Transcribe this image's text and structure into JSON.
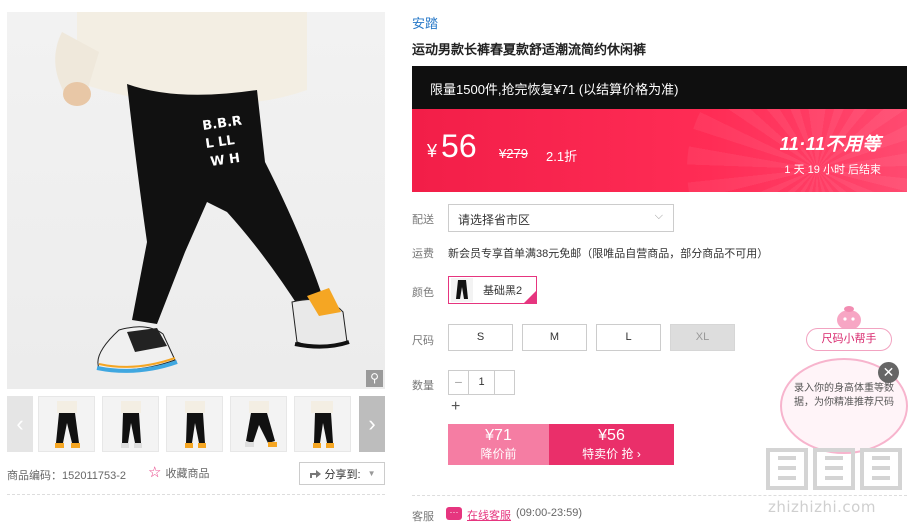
{
  "gallery": {
    "zoom_icon": "zoom-icon",
    "prev_icon": "chevron-left-icon",
    "next_icon": "chevron-right-icon",
    "thumbnail_count": 5
  },
  "product_meta": {
    "code": "商品编码：152011753-2",
    "favorite_label": "收藏商品",
    "share_label": "分享到:"
  },
  "product": {
    "brand": "安踏",
    "title": "运动男款长裤春夏款舒适潮流简约休闲裤"
  },
  "promo": {
    "banner": "限量1500件,抢完恢复¥71 (以结算价格为准)"
  },
  "price": {
    "symbol": "¥",
    "current": "56",
    "original": "¥279",
    "discount": "2.1折",
    "event_tag": "11·11不用等",
    "countdown": "1 天 19 小时 后结束"
  },
  "options": {
    "delivery_label": "配送",
    "delivery_placeholder": "请选择省市区",
    "shipping_label": "运费",
    "shipping_text": "新会员专享首单满38元免邮（限唯品自营商品，部分商品不可用）",
    "color_label": "颜色",
    "color_selected": "基础黑2",
    "size_label": "尺码",
    "sizes": [
      "S",
      "M",
      "L",
      "XL"
    ],
    "quantity_label": "数量",
    "quantity_value": "1",
    "minus_symbol": "−",
    "plus_symbol": "+"
  },
  "actions": {
    "presale_price": "¥71",
    "presale_label": "降价前",
    "buy_price": "¥56",
    "buy_label": "特卖价 抢 ›"
  },
  "service": {
    "label": "客服",
    "link": "在线客服",
    "hours": "(09:00-23:59)"
  },
  "size_helper": {
    "title": "尺码小帮手",
    "body": "录入你的身高体重等数据，为你精准推荐尺码",
    "close_symbol": "✕"
  },
  "watermark": {
    "text": "zhizhizhi.com"
  },
  "colors": {
    "accent": "#e6357f",
    "price_red": "#f21e48",
    "brand_blue": "#2879c8"
  }
}
